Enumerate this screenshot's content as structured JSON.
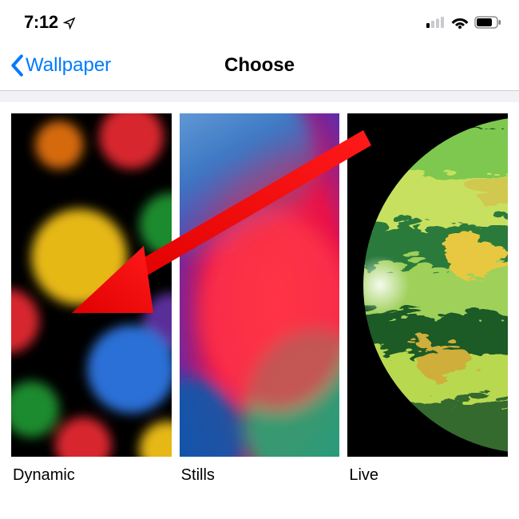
{
  "status": {
    "time": "7:12"
  },
  "nav": {
    "back_label": "Wallpaper",
    "title": "Choose"
  },
  "grid": {
    "items": [
      {
        "label": "Dynamic"
      },
      {
        "label": "Stills"
      },
      {
        "label": "Live"
      }
    ]
  },
  "colors": {
    "accent": "#007aff",
    "arrow": "#ff0a0a"
  }
}
